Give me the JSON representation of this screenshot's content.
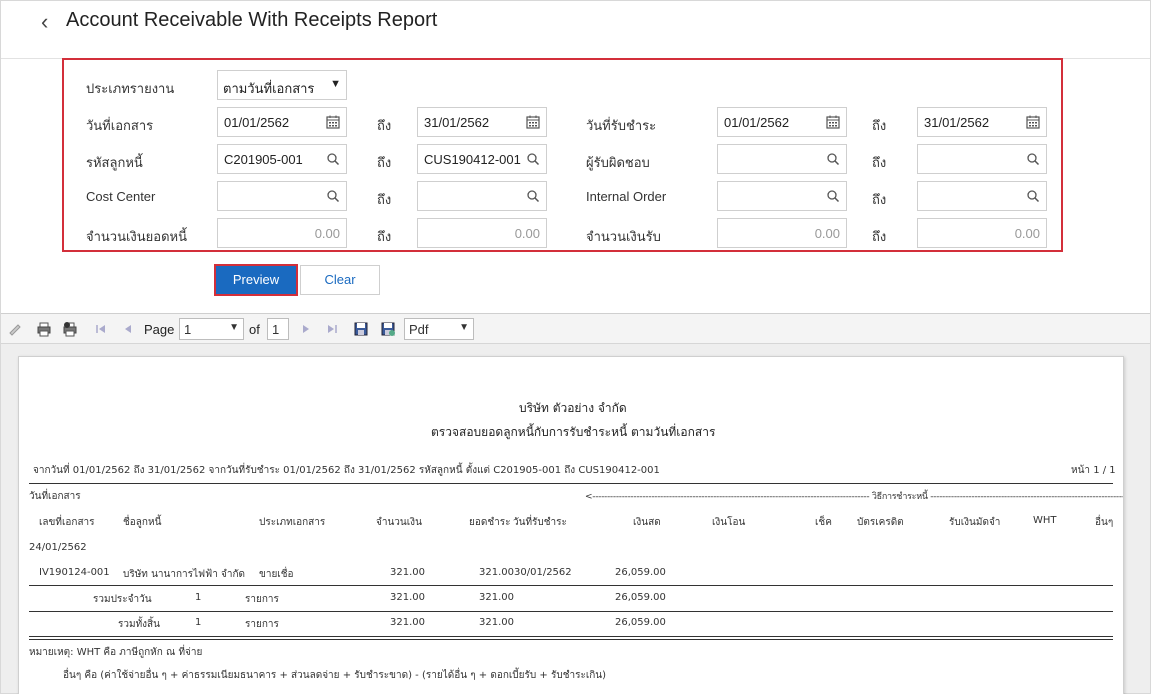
{
  "header": {
    "title": "Account Receivable With Receipts Report"
  },
  "filters": {
    "report_type_label": "ประเภทรายงาน",
    "report_type_value": "ตามวันที่เอกสาร",
    "to_label": "ถึง",
    "doc_date_label": "วันที่เอกสาร",
    "doc_date_from": "01/01/2562",
    "doc_date_to": "31/01/2562",
    "pay_date_label": "วันที่รับชำระ",
    "pay_date_from": "01/01/2562",
    "pay_date_to": "31/01/2562",
    "customer_label": "รหัสลูกหนี้",
    "customer_from": "C201905-001",
    "customer_to": "CUS190412-001",
    "responsible_label": "ผู้รับผิดชอบ",
    "cost_center_label": "Cost Center",
    "internal_order_label": "Internal Order",
    "ar_amount_label": "จำนวนเงินยอดหนี้",
    "ar_amount_from": "0.00",
    "ar_amount_to": "0.00",
    "received_amount_label": "จำนวนเงินรับ",
    "received_amount_from": "0.00",
    "received_amount_to": "0.00"
  },
  "actions": {
    "preview": "Preview",
    "clear": "Clear"
  },
  "toolbar": {
    "page_label": "Page",
    "page_value": "1",
    "of_label": "of",
    "total_pages": "1",
    "format_value": "Pdf"
  },
  "report": {
    "company": "บริษัท ตัวอย่าง จำกัด",
    "subtitle": "ตรวจสอบยอดลูกหนี้กับการรับชำระหนี้ ตามวันที่เอกสาร",
    "criteria": "จากวันที่ 01/01/2562 ถึง 31/01/2562 จากวันที่รับชำระ 01/01/2562 ถึง 31/01/2562 รหัสลูกหนี้ ตั้งแต่ C201905-001 ถึง CUS190412-001",
    "page_info": "หน้า 1 / 1",
    "doc_date_header": "วันที่เอกสาร",
    "payment_method_header": "<---------------------------------------------------------------------------------------------- วิธีการชำระหนี้ ---------------------------------------------------------------------------------------------->",
    "columns": [
      "เลขที่เอกสาร",
      "ชื่อลูกหนี้",
      "ประเภทเอกสาร",
      "จำนวนเงิน",
      "ยอดชำระ",
      "วันที่รับชำระ",
      "เงินสด",
      "เงินโอน",
      "เช็ค",
      "บัตรเครดิต",
      "รับเงินมัดจำ",
      "WHT",
      "อื่นๆ"
    ],
    "group_date": "24/01/2562",
    "row": {
      "doc_no": "IV190124-001",
      "customer": "บริษัท นานาการไฟฟ้า จำกัด",
      "doc_type": "ขายเชื่อ",
      "amount": "321.00",
      "paid": "321.00",
      "pay_date": "30/01/2562",
      "cash": "26,059.00"
    },
    "daily_total": {
      "label": "รวมประจำวัน",
      "count": "1",
      "unit": "รายการ",
      "amount": "321.00",
      "paid": "321.00",
      "cash": "26,059.00"
    },
    "grand_total": {
      "label": "รวมทั้งสิ้น",
      "count": "1",
      "unit": "รายการ",
      "amount": "321.00",
      "paid": "321.00",
      "cash": "26,059.00"
    },
    "note1": "หมายเหตุ: WHT คือ ภาษีถูกหัก ณ ที่จ่าย",
    "note2": "อื่นๆ คือ (ค่าใช้จ่ายอื่น ๆ + ค่าธรรมเนียมธนาคาร + ส่วนลดจ่าย + รับชำระขาด) - (รายได้อื่น ๆ + ดอกเบี้ยรับ + รับชำระเกิน)"
  }
}
